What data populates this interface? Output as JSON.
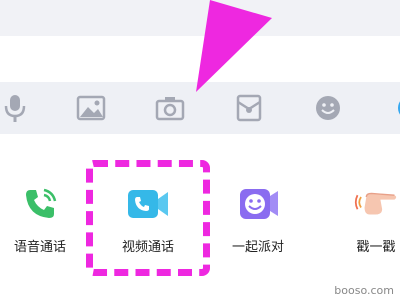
{
  "toolbar": {
    "icons": [
      "microphone-icon",
      "image-icon",
      "camera-icon",
      "red-packet-icon",
      "emoji-icon"
    ]
  },
  "panel": {
    "apps": [
      {
        "label": "语音通话",
        "icon": "phone-icon",
        "color": "#3bbf68"
      },
      {
        "label": "视频通话",
        "icon": "video-call-icon",
        "color": "#35b8e8"
      },
      {
        "label": "一起派对",
        "icon": "party-face-icon",
        "color": "#8a6cf0"
      },
      {
        "label": "戳一戳",
        "icon": "poke-hand-icon",
        "color": "#f0a080"
      }
    ]
  },
  "annotation": {
    "color": "#ee28e0"
  },
  "watermark": "booso.com"
}
